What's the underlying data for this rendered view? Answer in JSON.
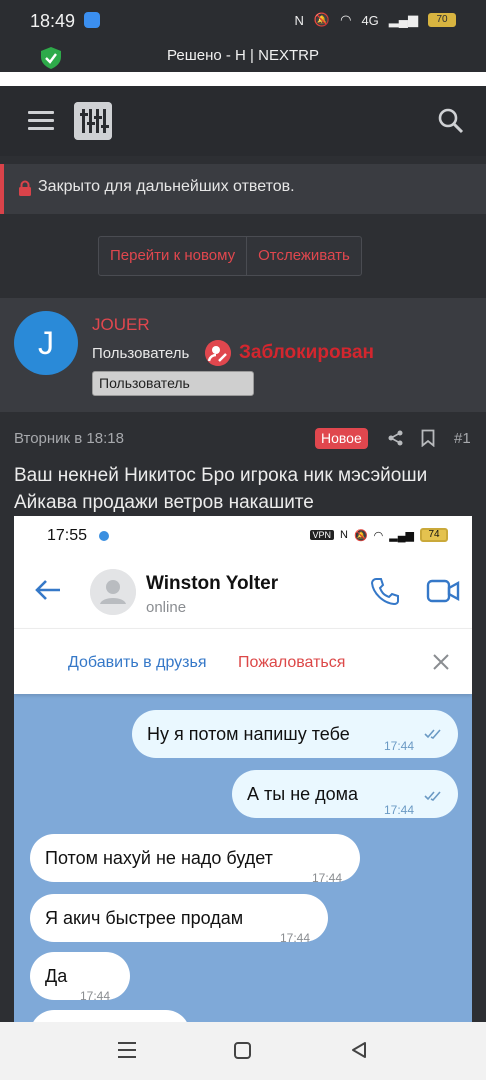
{
  "status_bar": {
    "time": "18:49",
    "battery": "70",
    "network": "4G",
    "icons": [
      "nfc-icon",
      "mute-icon",
      "wifi-icon",
      "signal-icon",
      "battery-icon"
    ]
  },
  "title_bar": {
    "title": "Решено - Н | NEXTRP"
  },
  "nav": {
    "icons": [
      "hamburger-icon",
      "logo-icon",
      "search-icon"
    ]
  },
  "notice": {
    "text": "Закрыто для дальнейших ответов."
  },
  "thread_buttons": {
    "go_new": "Перейти к новому",
    "watch": "Отслеживать"
  },
  "user": {
    "avatar_letter": "J",
    "name": "JOUER",
    "role": "Пользователь",
    "status": "Заблокирован",
    "badge": "Пользователь"
  },
  "post": {
    "date": "Вторник в 18:18",
    "new_badge": "Новое",
    "number": "#1",
    "text": "Ваш некней Никитос Бро игрока ник мэсэйоши Айкава продажи ветров накашите"
  },
  "screenshot": {
    "time": "17:55",
    "vpn": "VPN",
    "battery": "74",
    "contact_name": "Winston Yolter",
    "contact_status": "online",
    "add_friend": "Добавить в друзья",
    "report": "Пожаловаться",
    "messages": [
      {
        "text": "Ну я потом напишу тебе",
        "time": "17:44",
        "direction": "out"
      },
      {
        "text": "А ты не дома",
        "time": "17:44",
        "direction": "out"
      },
      {
        "text": "Потом нахуй не надо будет",
        "time": "17:44",
        "direction": "in"
      },
      {
        "text": "Я акич быстрее продам",
        "time": "17:44",
        "direction": "in"
      },
      {
        "text": "Да",
        "time": "17:44",
        "direction": "in"
      }
    ],
    "colors": {
      "chat_bg": "#7fa9d8",
      "out_bubble": "#eaf8ff",
      "in_bubble": "#ffffff",
      "accent": "#3578c8"
    }
  },
  "colors": {
    "accent_red": "#e0474e",
    "banned_red": "#d3262e",
    "avatar_blue": "#2a8ad8",
    "page_bg": "#2d2f33"
  },
  "system_nav": {
    "icons": [
      "recents-icon",
      "home-icon",
      "back-icon"
    ]
  }
}
